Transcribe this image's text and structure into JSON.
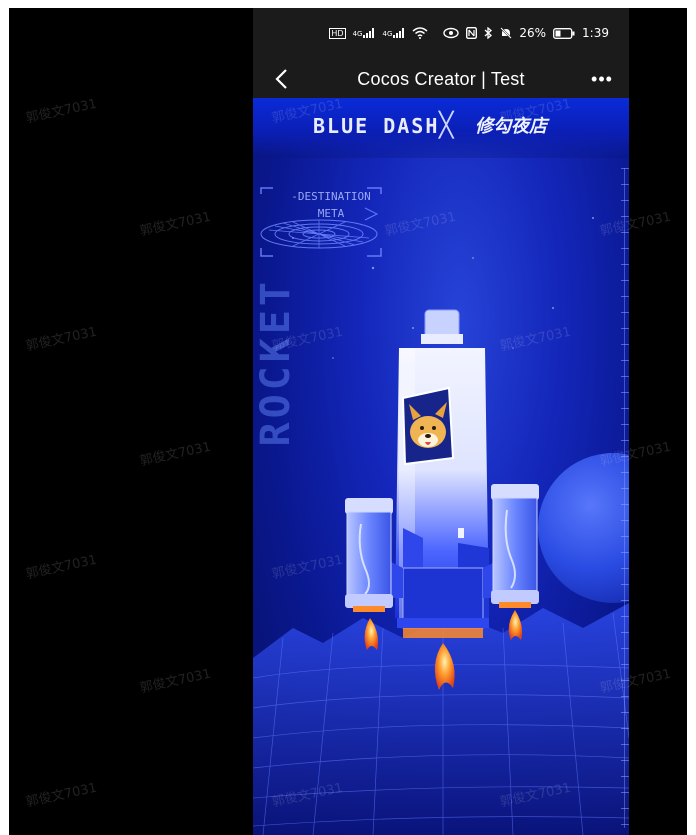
{
  "status_bar": {
    "network_left": "HD",
    "signal1": "4G",
    "signal2": "4G",
    "battery": "26%",
    "time": "1:39"
  },
  "nav": {
    "title": "Cocos Creator | Test",
    "more": "•••"
  },
  "game": {
    "brand": "BLUE DASH",
    "brand_separator": "╳",
    "partner": "修勾夜店",
    "destination_line1": "-DESTINATION",
    "destination_line2": "META",
    "vertical_text": "ROCKET"
  },
  "watermark": {
    "text": "郭俊文7031"
  },
  "colors": {
    "space_blue": "#1326b9",
    "status_bar_bg": "#1b1b1b",
    "rocket_white": "#e8ecff",
    "flame": "#ff7a1a"
  }
}
